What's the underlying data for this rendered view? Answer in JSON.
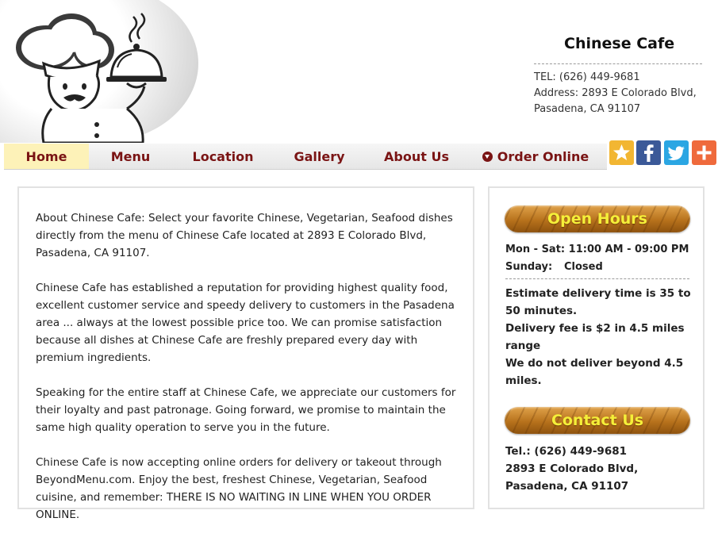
{
  "header": {
    "site_name": "Chinese Cafe",
    "tel": "TEL: (626) 449-9681",
    "address_line1": "Address: 2893 E Colorado Blvd,",
    "address_line2": "Pasadena, CA 91107",
    "logo_icon": "chef-with-cloche-icon"
  },
  "nav": {
    "items": [
      {
        "label": "Home",
        "active": true
      },
      {
        "label": "Menu"
      },
      {
        "label": "Location"
      },
      {
        "label": "Gallery"
      },
      {
        "label": "About Us"
      },
      {
        "label": "Order Online",
        "icon": "order-down-arrow-icon"
      }
    ]
  },
  "social": [
    {
      "name": "favorite-star-icon",
      "color": "#f2b632"
    },
    {
      "name": "facebook-icon",
      "color": "#3b5998"
    },
    {
      "name": "twitter-icon",
      "color": "#2ba6e3"
    },
    {
      "name": "share-plus-icon",
      "color": "#ef6a3c"
    }
  ],
  "about": {
    "paragraphs": [
      "About Chinese Cafe: Select your favorite Chinese, Vegetarian, Seafood dishes directly from the menu of Chinese Cafe located at 2893 E Colorado Blvd, Pasadena, CA 91107.",
      "Chinese Cafe has established a reputation for providing highest quality food, excellent customer service and speedy delivery to customers in the Pasadena area ... always at the lowest possible price too. We can promise satisfaction because all dishes at Chinese Cafe are freshly prepared every day with premium ingredients.",
      "Speaking for the entire staff at Chinese Cafe, we appreciate our customers for their loyalty and past patronage. Going forward, we promise to maintain the same high quality operation to serve you in the future.",
      "Chinese Cafe is now accepting online orders for delivery or takeout through BeyondMenu.com. Enjoy the best, freshest Chinese, Vegetarian, Seafood cuisine, and remember: THERE IS NO WAITING IN LINE WHEN YOU ORDER ONLINE."
    ]
  },
  "sidebar": {
    "hours_title": "Open Hours",
    "hours": [
      {
        "days": "Mon - Sat:",
        "time": "11:00 AM - 09:00 PM"
      },
      {
        "days": "Sunday:",
        "time": "Closed"
      }
    ],
    "delivery_lines": [
      "Estimate delivery time is 35 to 50 minutes.",
      "Delivery fee is $2 in 4.5 miles range",
      "We do not deliver beyond 4.5 miles."
    ],
    "contact_title": "Contact Us",
    "contact_lines": [
      "Tel.: (626) 449-9681",
      "2893 E Colorado Blvd,",
      "Pasadena, CA 91107"
    ]
  },
  "colors": {
    "nav_text": "#7a1414",
    "nav_active_bg": "#fdf2b8",
    "heading_text": "#f5ef39",
    "wood": "#b7721c"
  }
}
